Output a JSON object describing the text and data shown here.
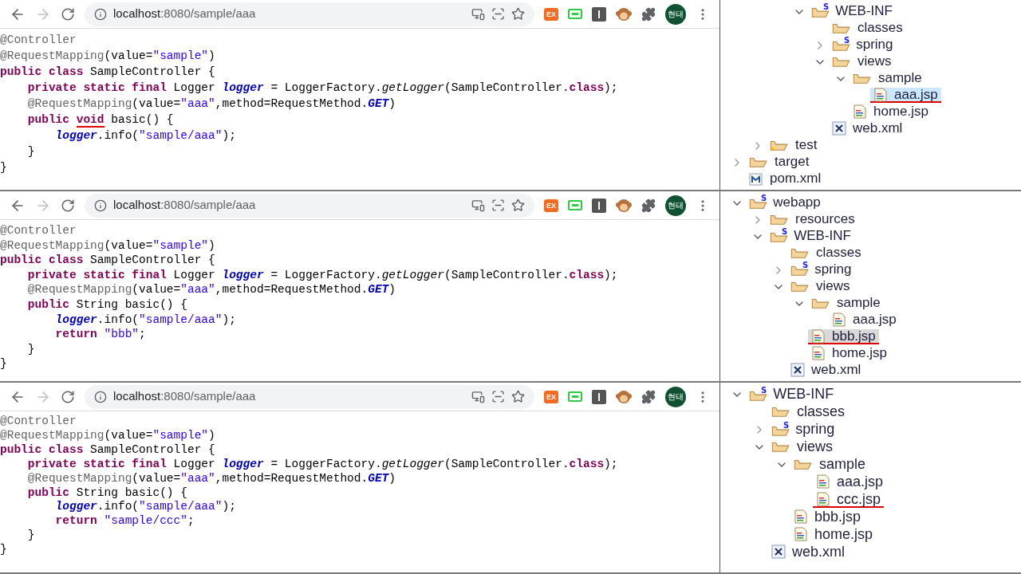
{
  "panels": [
    {
      "browser": {
        "host": "localhost",
        "path": ":8080/sample/aaa",
        "ext_label": "EX",
        "avatar": "현태"
      },
      "code": [
        [
          {
            "t": "@Controller",
            "kind": "ann"
          }
        ],
        [
          {
            "t": "@RequestMapping",
            "kind": "ann"
          },
          {
            "t": "(value=",
            "kind": "plain"
          },
          {
            "t": "\"sample\"",
            "kind": "str"
          },
          {
            "t": ")",
            "kind": "plain"
          }
        ],
        [
          {
            "t": "public class",
            "kind": "kw"
          },
          {
            "t": " SampleController {",
            "kind": "plain"
          }
        ],
        [
          {
            "t": "    private static final",
            "kind": "kw"
          },
          {
            "t": " Logger ",
            "kind": "plain"
          },
          {
            "t": "logger",
            "kind": "field"
          },
          {
            "t": " = LoggerFactory.",
            "kind": "plain"
          },
          {
            "t": "getLogger",
            "kind": "method"
          },
          {
            "t": "(SampleController.",
            "kind": "plain"
          },
          {
            "t": "class",
            "kind": "kw"
          },
          {
            "t": ");",
            "kind": "plain"
          }
        ],
        [
          {
            "t": "    @RequestMapping",
            "kind": "ann"
          },
          {
            "t": "(value=",
            "kind": "plain"
          },
          {
            "t": "\"aaa\"",
            "kind": "str"
          },
          {
            "t": ",method=RequestMethod.",
            "kind": "plain"
          },
          {
            "t": "GET",
            "kind": "const"
          },
          {
            "t": ")",
            "kind": "plain"
          }
        ],
        [
          {
            "t": "    public ",
            "kind": "kw"
          },
          {
            "t": "void",
            "kind": "kw_marked"
          },
          {
            "t": " basic() {",
            "kind": "plain"
          }
        ],
        [
          {
            "t": "        logger",
            "kind": "field"
          },
          {
            "t": ".info(",
            "kind": "plain"
          },
          {
            "t": "\"sample/aaa\"",
            "kind": "str"
          },
          {
            "t": ");",
            "kind": "plain"
          }
        ],
        [
          {
            "t": "    }",
            "kind": "plain"
          }
        ],
        [
          {
            "t": "}",
            "kind": "plain"
          }
        ]
      ],
      "tree_focused": true,
      "tree": [
        {
          "children": [
            {
              "children": [
                {
                  "children": [
                    {
                      "label": "WEB-INF",
                      "kind": "sfolder",
                      "badge": "S",
                      "expanded": true,
                      "selected": false,
                      "underlined": false,
                      "children": [
                        {
                          "label": "classes",
                          "kind": "folder",
                          "selected": false,
                          "underlined": false
                        },
                        {
                          "label": "spring",
                          "kind": "sfolder",
                          "badge": "S",
                          "expanded": false,
                          "selected": false,
                          "underlined": false
                        },
                        {
                          "label": "views",
                          "kind": "folder",
                          "expanded": true,
                          "selected": false,
                          "underlined": false,
                          "children": [
                            {
                              "label": "sample",
                              "kind": "folder",
                              "expanded": true,
                              "selected": false,
                              "underlined": false,
                              "children": [
                                {
                                  "label": "aaa.jsp",
                                  "kind": "jsp",
                                  "selected": true,
                                  "underlined": true
                                }
                              ]
                            },
                            {
                              "label": "home.jsp",
                              "kind": "jsp",
                              "selected": false,
                              "underlined": false
                            }
                          ]
                        },
                        {
                          "label": "web.xml",
                          "kind": "xml",
                          "selected": false,
                          "underlined": false
                        }
                      ]
                    }
                  ]
                }
              ]
            },
            {
              "label": "test",
              "kind": "warnfolder",
              "expanded": false,
              "selected": false,
              "underlined": false
            }
          ]
        },
        {
          "label": "target",
          "kind": "folder",
          "expanded": false,
          "selected": false,
          "underlined": false
        },
        {
          "label": "pom.xml",
          "kind": "maven",
          "selected": false,
          "underlined": false
        }
      ]
    },
    {
      "browser": {
        "host": "localhost",
        "path": ":8080/sample/aaa",
        "ext_label": "EX",
        "avatar": "현태"
      },
      "code": [
        [
          {
            "t": "@Controller",
            "kind": "ann"
          }
        ],
        [
          {
            "t": "@RequestMapping",
            "kind": "ann"
          },
          {
            "t": "(value=",
            "kind": "plain"
          },
          {
            "t": "\"sample\"",
            "kind": "str"
          },
          {
            "t": ")",
            "kind": "plain"
          }
        ],
        [
          {
            "t": "public class",
            "kind": "kw"
          },
          {
            "t": " SampleController {",
            "kind": "plain"
          }
        ],
        [
          {
            "t": "    private static final",
            "kind": "kw"
          },
          {
            "t": " Logger ",
            "kind": "plain"
          },
          {
            "t": "logger",
            "kind": "field"
          },
          {
            "t": " = LoggerFactory.",
            "kind": "plain"
          },
          {
            "t": "getLogger",
            "kind": "method"
          },
          {
            "t": "(SampleController.",
            "kind": "plain"
          },
          {
            "t": "class",
            "kind": "kw"
          },
          {
            "t": ");",
            "kind": "plain"
          }
        ],
        [
          {
            "t": "    @RequestMapping",
            "kind": "ann"
          },
          {
            "t": "(value=",
            "kind": "plain"
          },
          {
            "t": "\"aaa\"",
            "kind": "str"
          },
          {
            "t": ",method=RequestMethod.",
            "kind": "plain"
          },
          {
            "t": "GET",
            "kind": "const"
          },
          {
            "t": ")",
            "kind": "plain"
          }
        ],
        [
          {
            "t": "    public",
            "kind": "kw"
          },
          {
            "t": " String basic() {",
            "kind": "plain"
          }
        ],
        [
          {
            "t": "        logger",
            "kind": "field"
          },
          {
            "t": ".info(",
            "kind": "plain"
          },
          {
            "t": "\"sample/aaa\"",
            "kind": "str"
          },
          {
            "t": ");",
            "kind": "plain"
          }
        ],
        [
          {
            "t": "        return",
            "kind": "kw"
          },
          {
            "t": " \"bbb\"",
            "kind": "str"
          },
          {
            "t": ";",
            "kind": "plain"
          }
        ],
        [
          {
            "t": "    }",
            "kind": "plain"
          }
        ],
        [
          {
            "t": "}",
            "kind": "plain"
          }
        ]
      ],
      "tree_focused": false,
      "tree": [
        {
          "label": "webapp",
          "kind": "sfolder",
          "badge": "S",
          "expanded": true,
          "selected": false,
          "underlined": false,
          "children": [
            {
              "label": "resources",
              "kind": "folder",
              "expanded": false,
              "selected": false,
              "underlined": false
            },
            {
              "label": "WEB-INF",
              "kind": "sfolder",
              "badge": "S",
              "expanded": true,
              "selected": false,
              "underlined": false,
              "children": [
                {
                  "label": "classes",
                  "kind": "folder",
                  "selected": false,
                  "underlined": false
                },
                {
                  "label": "spring",
                  "kind": "sfolder",
                  "badge": "S",
                  "expanded": false,
                  "selected": false,
                  "underlined": false
                },
                {
                  "label": "views",
                  "kind": "folder",
                  "expanded": true,
                  "selected": false,
                  "underlined": false,
                  "children": [
                    {
                      "label": "sample",
                      "kind": "folder",
                      "expanded": true,
                      "selected": false,
                      "underlined": false,
                      "children": [
                        {
                          "label": "aaa.jsp",
                          "kind": "jsp",
                          "selected": false,
                          "underlined": false
                        }
                      ]
                    },
                    {
                      "label": "bbb.jsp",
                      "kind": "jsp",
                      "selected": true,
                      "underlined": true
                    },
                    {
                      "label": "home.jsp",
                      "kind": "jsp",
                      "selected": false,
                      "underlined": false
                    }
                  ]
                },
                {
                  "label": "web.xml",
                  "kind": "xml",
                  "selected": false,
                  "underlined": false
                }
              ]
            }
          ]
        }
      ]
    },
    {
      "browser": {
        "host": "localhost",
        "path": ":8080/sample/aaa",
        "ext_label": "EX",
        "avatar": "현태"
      },
      "code": [
        [
          {
            "t": "@Controller",
            "kind": "ann"
          }
        ],
        [
          {
            "t": "@RequestMapping",
            "kind": "ann"
          },
          {
            "t": "(value=",
            "kind": "plain"
          },
          {
            "t": "\"sample\"",
            "kind": "str"
          },
          {
            "t": ")",
            "kind": "plain"
          }
        ],
        [
          {
            "t": "public class",
            "kind": "kw"
          },
          {
            "t": " SampleController {",
            "kind": "plain"
          }
        ],
        [
          {
            "t": "    private static final",
            "kind": "kw"
          },
          {
            "t": " Logger ",
            "kind": "plain"
          },
          {
            "t": "logger",
            "kind": "field"
          },
          {
            "t": " = LoggerFactory.",
            "kind": "plain"
          },
          {
            "t": "getLogger",
            "kind": "method"
          },
          {
            "t": "(SampleController.",
            "kind": "plain"
          },
          {
            "t": "class",
            "kind": "kw"
          },
          {
            "t": ");",
            "kind": "plain"
          }
        ],
        [
          {
            "t": "    @RequestMapping",
            "kind": "ann"
          },
          {
            "t": "(value=",
            "kind": "plain"
          },
          {
            "t": "\"aaa\"",
            "kind": "str"
          },
          {
            "t": ",method=RequestMethod.",
            "kind": "plain"
          },
          {
            "t": "GET",
            "kind": "const"
          },
          {
            "t": ")",
            "kind": "plain"
          }
        ],
        [
          {
            "t": "    public",
            "kind": "kw"
          },
          {
            "t": " String basic() {",
            "kind": "plain"
          }
        ],
        [
          {
            "t": "        logger",
            "kind": "field"
          },
          {
            "t": ".info(",
            "kind": "plain"
          },
          {
            "t": "\"sample/aaa\"",
            "kind": "str"
          },
          {
            "t": ");",
            "kind": "plain"
          }
        ],
        [
          {
            "t": "        return",
            "kind": "kw"
          },
          {
            "t": " \"sample/ccc\"",
            "kind": "str"
          },
          {
            "t": ";",
            "kind": "plain"
          }
        ],
        [
          {
            "t": "    }",
            "kind": "plain"
          }
        ],
        [
          {
            "t": "}",
            "kind": "plain"
          }
        ]
      ],
      "tree": [
        {
          "label": "WEB-INF",
          "kind": "sfolder",
          "badge": "S",
          "expanded": true,
          "selected": false,
          "underlined": false,
          "children": [
            {
              "label": "classes",
              "kind": "folder",
              "selected": false,
              "underlined": false
            },
            {
              "label": "spring",
              "kind": "sfolder",
              "badge": "S",
              "expanded": false,
              "selected": false,
              "underlined": false
            },
            {
              "label": "views",
              "kind": "folder",
              "expanded": true,
              "selected": false,
              "underlined": false,
              "children": [
                {
                  "label": "sample",
                  "kind": "folder",
                  "expanded": true,
                  "selected": false,
                  "underlined": false,
                  "children": [
                    {
                      "label": "aaa.jsp",
                      "kind": "jsp",
                      "selected": false,
                      "underlined": false
                    },
                    {
                      "label": "ccc.jsp",
                      "kind": "jsp",
                      "selected": false,
                      "underlined": true
                    }
                  ]
                },
                {
                  "label": "bbb.jsp",
                  "kind": "jsp",
                  "selected": false,
                  "underlined": false
                },
                {
                  "label": "home.jsp",
                  "kind": "jsp",
                  "selected": false,
                  "underlined": false
                }
              ]
            },
            {
              "label": "web.xml",
              "kind": "xml",
              "selected": false,
              "underlined": false
            }
          ]
        }
      ]
    }
  ]
}
